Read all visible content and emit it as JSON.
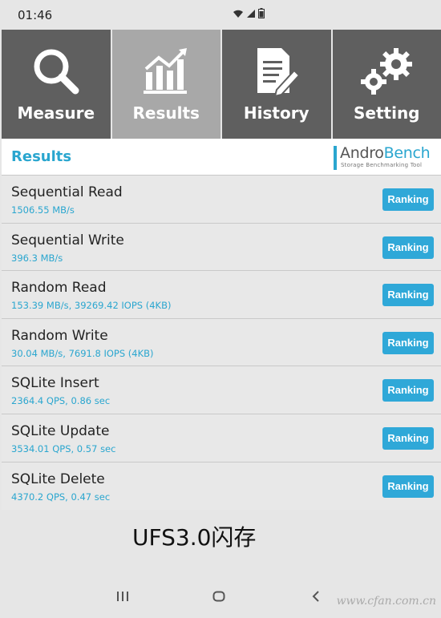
{
  "status": {
    "time": "01:46",
    "signal_icon": "wifi-icon",
    "battery_icon": "battery-icon"
  },
  "tabs": [
    {
      "label": "Measure",
      "icon": "magnifier-icon",
      "active": false
    },
    {
      "label": "Results",
      "icon": "bar-chart-icon",
      "active": true
    },
    {
      "label": "History",
      "icon": "document-pen-icon",
      "active": false
    },
    {
      "label": "Setting",
      "icon": "gears-icon",
      "active": false
    }
  ],
  "header": {
    "title": "Results",
    "logo": {
      "brand_a": "Andro",
      "brand_b": "Bench",
      "tagline": "Storage Benchmarking Tool"
    }
  },
  "results": [
    {
      "name": "Sequential Read",
      "value": "1506.55 MB/s",
      "button": "Ranking"
    },
    {
      "name": "Sequential Write",
      "value": "396.3 MB/s",
      "button": "Ranking"
    },
    {
      "name": "Random Read",
      "value": "153.39 MB/s, 39269.42 IOPS (4KB)",
      "button": "Ranking"
    },
    {
      "name": "Random Write",
      "value": "30.04 MB/s, 7691.8 IOPS (4KB)",
      "button": "Ranking"
    },
    {
      "name": "SQLite Insert",
      "value": "2364.4 QPS, 0.86 sec",
      "button": "Ranking"
    },
    {
      "name": "SQLite Update",
      "value": "3534.01 QPS, 0.57 sec",
      "button": "Ranking"
    },
    {
      "name": "SQLite Delete",
      "value": "4370.2 QPS, 0.47 sec",
      "button": "Ranking"
    }
  ],
  "overlay_text": "UFS3.0闪存",
  "navbar": {
    "recent": "recent-apps-icon",
    "home": "home-icon",
    "back": "back-icon"
  },
  "watermark": "www.cfan.com.cn",
  "colors": {
    "accent": "#2aa6cf",
    "tab_bg": "#5f5f5f",
    "tab_active": "#a8a8a8",
    "button": "#2fa8d8"
  }
}
